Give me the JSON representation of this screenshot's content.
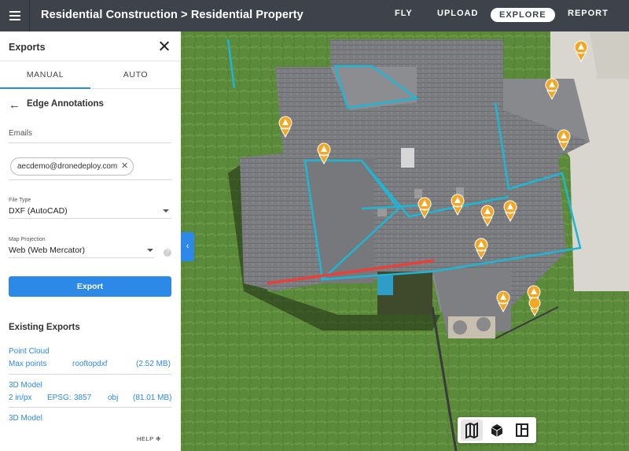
{
  "header": {
    "breadcrumb": "Residential Construction > Residential Property",
    "nav": {
      "fly": "FLY",
      "upload": "UPLOAD",
      "explore": "EXPLORE",
      "report": "REPORT"
    }
  },
  "panel": {
    "title": "Exports",
    "tabs": {
      "manual": "MANUAL",
      "auto": "AUTO"
    },
    "subtitle": "Edge Annotations",
    "emails_label": "Emails",
    "email_chip": "aecdemo@dronedeploy.com",
    "file_type_label": "File Type",
    "file_type_value": "DXF (AutoCAD)",
    "projection_label": "Map Projection",
    "projection_value": "Web (Web Mercator)",
    "help_q": "?",
    "export_button": "Export",
    "existing_title": "Existing Exports",
    "exports": [
      {
        "name": "Point Cloud",
        "c1": "Max points",
        "c2": "rooftopdxf",
        "c3": "",
        "size": "(2.52 MB)"
      },
      {
        "name": "3D Model",
        "c1": "2 in/px",
        "c2": "EPSG:",
        "c3": "3857",
        "c4": "obj",
        "size": "(81.01 MB)"
      },
      {
        "name": "3D Model"
      }
    ],
    "help": "HELP"
  },
  "colors": {
    "accent": "#2c89e8",
    "annotation": "#1fb6d6",
    "edge_red": "#e8403a",
    "marker": "#f5a623"
  }
}
